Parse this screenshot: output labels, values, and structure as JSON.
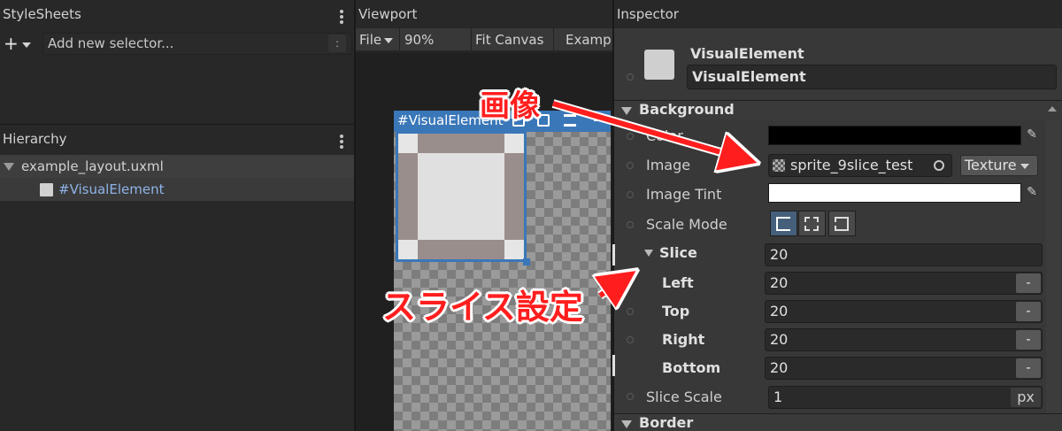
{
  "stylesheets": {
    "title": "StyleSheets",
    "add_button": "+",
    "selector_placeholder": "Add new selector...",
    "selector_colon": ":"
  },
  "hierarchy": {
    "title": "Hierarchy",
    "root": "example_layout.uxml",
    "child": "#VisualElement"
  },
  "viewport": {
    "title": "Viewport",
    "toolbar": {
      "file": "File",
      "zoom": "90%",
      "fit": "Fit Canvas",
      "example": "Examp"
    },
    "element_header": "#VisualElement"
  },
  "inspector": {
    "title": "Inspector",
    "element_type": "VisualElement",
    "element_name": "VisualElement",
    "background_section": "Background",
    "color_label": "Color",
    "color_value": "#000000",
    "image_label": "Image",
    "image_value": "sprite_9slice_test",
    "image_type": "Texture",
    "tint_label": "Image Tint",
    "tint_value": "#FFFFFF",
    "scale_mode_label": "Scale Mode",
    "slice_label": "Slice",
    "slice_value": "20",
    "left_label": "Left",
    "left_value": "20",
    "top_label": "Top",
    "top_value": "20",
    "right_label": "Right",
    "right_value": "20",
    "bottom_label": "Bottom",
    "bottom_value": "20",
    "minus": "-",
    "slice_scale_label": "Slice Scale",
    "slice_scale_value": "1",
    "slice_scale_unit": "px",
    "border_section": "Border"
  },
  "annotations": {
    "image_note": "画像",
    "slice_note": "スライス設定",
    "color": "#ff1e1e"
  }
}
